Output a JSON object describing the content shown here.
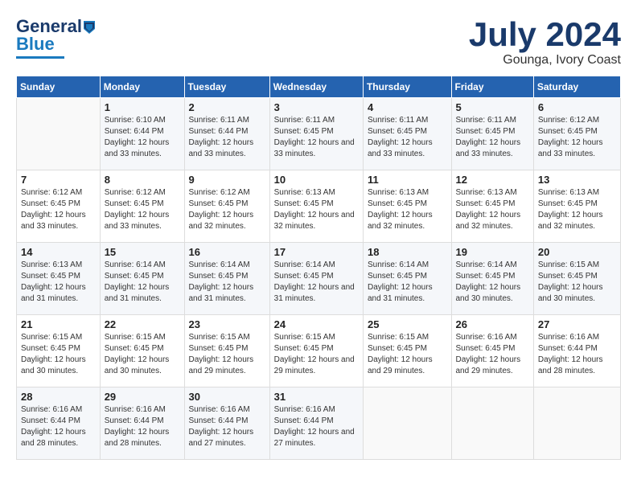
{
  "header": {
    "logo_general": "General",
    "logo_blue": "Blue",
    "month_title": "July 2024",
    "location": "Gounga, Ivory Coast"
  },
  "weekdays": [
    "Sunday",
    "Monday",
    "Tuesday",
    "Wednesday",
    "Thursday",
    "Friday",
    "Saturday"
  ],
  "weeks": [
    [
      {
        "day": "",
        "sunrise": "",
        "sunset": "",
        "daylight": ""
      },
      {
        "day": "1",
        "sunrise": "Sunrise: 6:10 AM",
        "sunset": "Sunset: 6:44 PM",
        "daylight": "Daylight: 12 hours and 33 minutes."
      },
      {
        "day": "2",
        "sunrise": "Sunrise: 6:11 AM",
        "sunset": "Sunset: 6:44 PM",
        "daylight": "Daylight: 12 hours and 33 minutes."
      },
      {
        "day": "3",
        "sunrise": "Sunrise: 6:11 AM",
        "sunset": "Sunset: 6:45 PM",
        "daylight": "Daylight: 12 hours and 33 minutes."
      },
      {
        "day": "4",
        "sunrise": "Sunrise: 6:11 AM",
        "sunset": "Sunset: 6:45 PM",
        "daylight": "Daylight: 12 hours and 33 minutes."
      },
      {
        "day": "5",
        "sunrise": "Sunrise: 6:11 AM",
        "sunset": "Sunset: 6:45 PM",
        "daylight": "Daylight: 12 hours and 33 minutes."
      },
      {
        "day": "6",
        "sunrise": "Sunrise: 6:12 AM",
        "sunset": "Sunset: 6:45 PM",
        "daylight": "Daylight: 12 hours and 33 minutes."
      }
    ],
    [
      {
        "day": "7",
        "sunrise": "Sunrise: 6:12 AM",
        "sunset": "Sunset: 6:45 PM",
        "daylight": "Daylight: 12 hours and 33 minutes."
      },
      {
        "day": "8",
        "sunrise": "Sunrise: 6:12 AM",
        "sunset": "Sunset: 6:45 PM",
        "daylight": "Daylight: 12 hours and 33 minutes."
      },
      {
        "day": "9",
        "sunrise": "Sunrise: 6:12 AM",
        "sunset": "Sunset: 6:45 PM",
        "daylight": "Daylight: 12 hours and 32 minutes."
      },
      {
        "day": "10",
        "sunrise": "Sunrise: 6:13 AM",
        "sunset": "Sunset: 6:45 PM",
        "daylight": "Daylight: 12 hours and 32 minutes."
      },
      {
        "day": "11",
        "sunrise": "Sunrise: 6:13 AM",
        "sunset": "Sunset: 6:45 PM",
        "daylight": "Daylight: 12 hours and 32 minutes."
      },
      {
        "day": "12",
        "sunrise": "Sunrise: 6:13 AM",
        "sunset": "Sunset: 6:45 PM",
        "daylight": "Daylight: 12 hours and 32 minutes."
      },
      {
        "day": "13",
        "sunrise": "Sunrise: 6:13 AM",
        "sunset": "Sunset: 6:45 PM",
        "daylight": "Daylight: 12 hours and 32 minutes."
      }
    ],
    [
      {
        "day": "14",
        "sunrise": "Sunrise: 6:13 AM",
        "sunset": "Sunset: 6:45 PM",
        "daylight": "Daylight: 12 hours and 31 minutes."
      },
      {
        "day": "15",
        "sunrise": "Sunrise: 6:14 AM",
        "sunset": "Sunset: 6:45 PM",
        "daylight": "Daylight: 12 hours and 31 minutes."
      },
      {
        "day": "16",
        "sunrise": "Sunrise: 6:14 AM",
        "sunset": "Sunset: 6:45 PM",
        "daylight": "Daylight: 12 hours and 31 minutes."
      },
      {
        "day": "17",
        "sunrise": "Sunrise: 6:14 AM",
        "sunset": "Sunset: 6:45 PM",
        "daylight": "Daylight: 12 hours and 31 minutes."
      },
      {
        "day": "18",
        "sunrise": "Sunrise: 6:14 AM",
        "sunset": "Sunset: 6:45 PM",
        "daylight": "Daylight: 12 hours and 31 minutes."
      },
      {
        "day": "19",
        "sunrise": "Sunrise: 6:14 AM",
        "sunset": "Sunset: 6:45 PM",
        "daylight": "Daylight: 12 hours and 30 minutes."
      },
      {
        "day": "20",
        "sunrise": "Sunrise: 6:15 AM",
        "sunset": "Sunset: 6:45 PM",
        "daylight": "Daylight: 12 hours and 30 minutes."
      }
    ],
    [
      {
        "day": "21",
        "sunrise": "Sunrise: 6:15 AM",
        "sunset": "Sunset: 6:45 PM",
        "daylight": "Daylight: 12 hours and 30 minutes."
      },
      {
        "day": "22",
        "sunrise": "Sunrise: 6:15 AM",
        "sunset": "Sunset: 6:45 PM",
        "daylight": "Daylight: 12 hours and 30 minutes."
      },
      {
        "day": "23",
        "sunrise": "Sunrise: 6:15 AM",
        "sunset": "Sunset: 6:45 PM",
        "daylight": "Daylight: 12 hours and 29 minutes."
      },
      {
        "day": "24",
        "sunrise": "Sunrise: 6:15 AM",
        "sunset": "Sunset: 6:45 PM",
        "daylight": "Daylight: 12 hours and 29 minutes."
      },
      {
        "day": "25",
        "sunrise": "Sunrise: 6:15 AM",
        "sunset": "Sunset: 6:45 PM",
        "daylight": "Daylight: 12 hours and 29 minutes."
      },
      {
        "day": "26",
        "sunrise": "Sunrise: 6:16 AM",
        "sunset": "Sunset: 6:45 PM",
        "daylight": "Daylight: 12 hours and 29 minutes."
      },
      {
        "day": "27",
        "sunrise": "Sunrise: 6:16 AM",
        "sunset": "Sunset: 6:44 PM",
        "daylight": "Daylight: 12 hours and 28 minutes."
      }
    ],
    [
      {
        "day": "28",
        "sunrise": "Sunrise: 6:16 AM",
        "sunset": "Sunset: 6:44 PM",
        "daylight": "Daylight: 12 hours and 28 minutes."
      },
      {
        "day": "29",
        "sunrise": "Sunrise: 6:16 AM",
        "sunset": "Sunset: 6:44 PM",
        "daylight": "Daylight: 12 hours and 28 minutes."
      },
      {
        "day": "30",
        "sunrise": "Sunrise: 6:16 AM",
        "sunset": "Sunset: 6:44 PM",
        "daylight": "Daylight: 12 hours and 27 minutes."
      },
      {
        "day": "31",
        "sunrise": "Sunrise: 6:16 AM",
        "sunset": "Sunset: 6:44 PM",
        "daylight": "Daylight: 12 hours and 27 minutes."
      },
      {
        "day": "",
        "sunrise": "",
        "sunset": "",
        "daylight": ""
      },
      {
        "day": "",
        "sunrise": "",
        "sunset": "",
        "daylight": ""
      },
      {
        "day": "",
        "sunrise": "",
        "sunset": "",
        "daylight": ""
      }
    ]
  ]
}
